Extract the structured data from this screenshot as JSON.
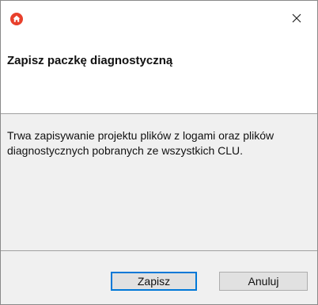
{
  "window": {
    "app_icon": "home-app-icon",
    "close_icon": "close-icon"
  },
  "header": {
    "title": "Zapisz paczkę diagnostyczną"
  },
  "body": {
    "message": "Trwa zapisywanie projektu plików z logami oraz plików diagnostycznych pobranych ze wszystkich CLU."
  },
  "footer": {
    "save_label": "Zapisz",
    "cancel_label": "Anuluj"
  },
  "colors": {
    "app_icon": "#e8402c",
    "accent": "#0078d7",
    "panel_bg": "#f0f0f0"
  }
}
